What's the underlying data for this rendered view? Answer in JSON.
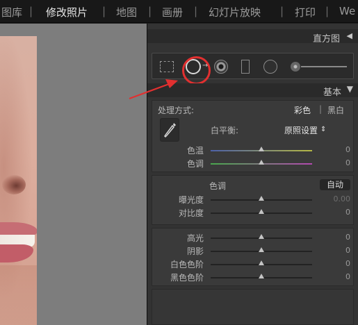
{
  "topbar": {
    "modules": [
      {
        "label": "图库",
        "active": false
      },
      {
        "label": "修改照片",
        "active": true
      },
      {
        "label": "地图",
        "active": false
      },
      {
        "label": "画册",
        "active": false
      },
      {
        "label": "幻灯片放映",
        "active": false
      },
      {
        "label": "打印",
        "active": false
      },
      {
        "label": "We",
        "active": false
      }
    ],
    "separator": "|"
  },
  "histogram_panel": {
    "title": "直方图",
    "toggle_icon": "triangle-left-icon"
  },
  "toolstrip": {
    "tools": [
      "crop-overlay-icon",
      "spot-removal-icon",
      "red-eye-correction-icon",
      "graduated-filter-icon",
      "radial-filter-icon",
      "adjustment-brush-icon"
    ],
    "highlighted_tool": "spot-removal-icon"
  },
  "annotation": {
    "arrow_color": "#e23030",
    "circle_color": "#e23030"
  },
  "basic_panel": {
    "title": "基本",
    "toggle_icon": "triangle-down-icon",
    "treatment": {
      "label": "处理方式:",
      "color": "彩色",
      "divider": "|",
      "bw": "黑白"
    },
    "white_balance": {
      "label": "白平衡:",
      "value": "原照设置",
      "caret": "⇕"
    },
    "temp": {
      "label": "色温",
      "value": "0",
      "fraction": 0.5
    },
    "tint": {
      "label": "色调",
      "value": "0",
      "fraction": 0.5
    },
    "tone": {
      "label": "色调",
      "auto_label": "自动"
    },
    "exposure": {
      "label": "曝光度",
      "value": "0.00",
      "fraction": 0.5
    },
    "contrast": {
      "label": "对比度",
      "value": "0",
      "fraction": 0.5
    },
    "highlights": {
      "label": "高光",
      "value": "0",
      "fraction": 0.5
    },
    "shadows": {
      "label": "阴影",
      "value": "0",
      "fraction": 0.5
    },
    "whites": {
      "label": "白色色阶",
      "value": "0",
      "fraction": 0.5
    },
    "blacks": {
      "label": "黑色色阶",
      "value": "0",
      "fraction": 0.5
    }
  }
}
